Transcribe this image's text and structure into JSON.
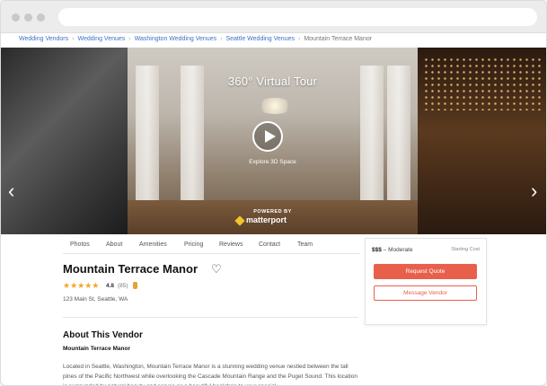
{
  "breadcrumb": {
    "items": [
      "Wedding Vendors",
      "Wedding Venues",
      "Washington Wedding Venues",
      "Seattle Wedding Venues"
    ],
    "current": "Mountain Terrace Manor"
  },
  "gallery": {
    "tour_title": "360° Virtual Tour",
    "explore_label": "Explore 3D Space",
    "powered_by": "POWERED BY",
    "brand": "matterport"
  },
  "tabs": [
    "Photos",
    "About",
    "Amenities",
    "Pricing",
    "Reviews",
    "Contact",
    "Team"
  ],
  "vendor": {
    "name": "Mountain Terrace Manor",
    "rating": "4.8",
    "review_count": "(85)",
    "stars": "★★★★★",
    "address": "123 Main St, Seattle, WA"
  },
  "about": {
    "heading": "About This Vendor",
    "subheading": "Mountain Terrace Manor",
    "text": "Located in Seattle, Washington, Mountain Terrace Manor is a stunning wedding venue nestled between the tall pines of the Pacific Northwest while overlooking the Cascade Mountain Range and the Puget Sound. This location is surrounded by natural beauty and serves as a beautiful backdrop to your special"
  },
  "quote_card": {
    "price_symbol": "$$$",
    "price_level": "– Moderate",
    "starting_cost_label": "Starting Cost",
    "request_quote_label": "Request Quote",
    "message_vendor_label": "Message Vendor"
  },
  "colors": {
    "link": "#3b73c9",
    "accent": "#e8604c",
    "star": "#f5a623"
  },
  "icons": [
    "heart-icon",
    "play-icon",
    "chevron-left-icon",
    "chevron-right-icon",
    "badge-icon",
    "matterport-logo-icon"
  ]
}
